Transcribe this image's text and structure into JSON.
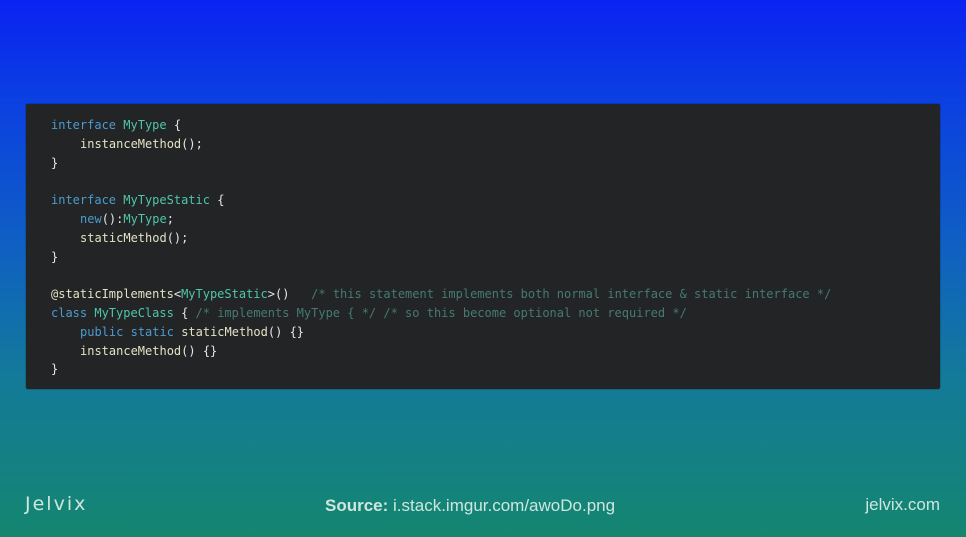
{
  "code": {
    "lines": [
      [
        {
          "t": "interface",
          "c": "kw"
        },
        {
          "t": " "
        },
        {
          "t": "MyType",
          "c": "ty"
        },
        {
          "t": " {",
          "c": "pn"
        }
      ],
      [
        {
          "t": "",
          "c": "indent"
        },
        {
          "t": "instanceMethod",
          "c": "fn"
        },
        {
          "t": "();",
          "c": "pn"
        }
      ],
      [
        {
          "t": "}",
          "c": "pn"
        }
      ],
      [],
      [
        {
          "t": "interface",
          "c": "kw"
        },
        {
          "t": " "
        },
        {
          "t": "MyTypeStatic",
          "c": "ty"
        },
        {
          "t": " {",
          "c": "pn"
        }
      ],
      [
        {
          "t": "",
          "c": "indent"
        },
        {
          "t": "new",
          "c": "kw"
        },
        {
          "t": "():",
          "c": "pn"
        },
        {
          "t": "MyType",
          "c": "ty"
        },
        {
          "t": ";",
          "c": "pn"
        }
      ],
      [
        {
          "t": "",
          "c": "indent"
        },
        {
          "t": "staticMethod",
          "c": "fn"
        },
        {
          "t": "();",
          "c": "pn"
        }
      ],
      [
        {
          "t": "}",
          "c": "pn"
        }
      ],
      [],
      [
        {
          "t": "@staticImplements",
          "c": "dec"
        },
        {
          "t": "<",
          "c": "pn"
        },
        {
          "t": "MyTypeStatic",
          "c": "ty"
        },
        {
          "t": ">()",
          "c": "pn"
        },
        {
          "t": "   "
        },
        {
          "t": "/* this statement implements both normal interface & static interface */",
          "c": "cm"
        }
      ],
      [
        {
          "t": "class",
          "c": "kw"
        },
        {
          "t": " "
        },
        {
          "t": "MyTypeClass",
          "c": "ty"
        },
        {
          "t": " { ",
          "c": "pn"
        },
        {
          "t": "/* implements MyType { */ /* so this become optional not required */",
          "c": "cm"
        }
      ],
      [
        {
          "t": "",
          "c": "indent"
        },
        {
          "t": "public",
          "c": "kw"
        },
        {
          "t": " "
        },
        {
          "t": "static",
          "c": "kw"
        },
        {
          "t": " "
        },
        {
          "t": "staticMethod",
          "c": "fn"
        },
        {
          "t": "() {}",
          "c": "pn"
        }
      ],
      [
        {
          "t": "",
          "c": "indent"
        },
        {
          "t": "instanceMethod",
          "c": "fn"
        },
        {
          "t": "() {}",
          "c": "pn"
        }
      ],
      [
        {
          "t": "}",
          "c": "pn"
        }
      ]
    ]
  },
  "footer": {
    "logo": "Jelvix",
    "source_label": "Source:",
    "source_url": " i.stack.imgur.com/awoDo.png",
    "site": "jelvix.com"
  }
}
